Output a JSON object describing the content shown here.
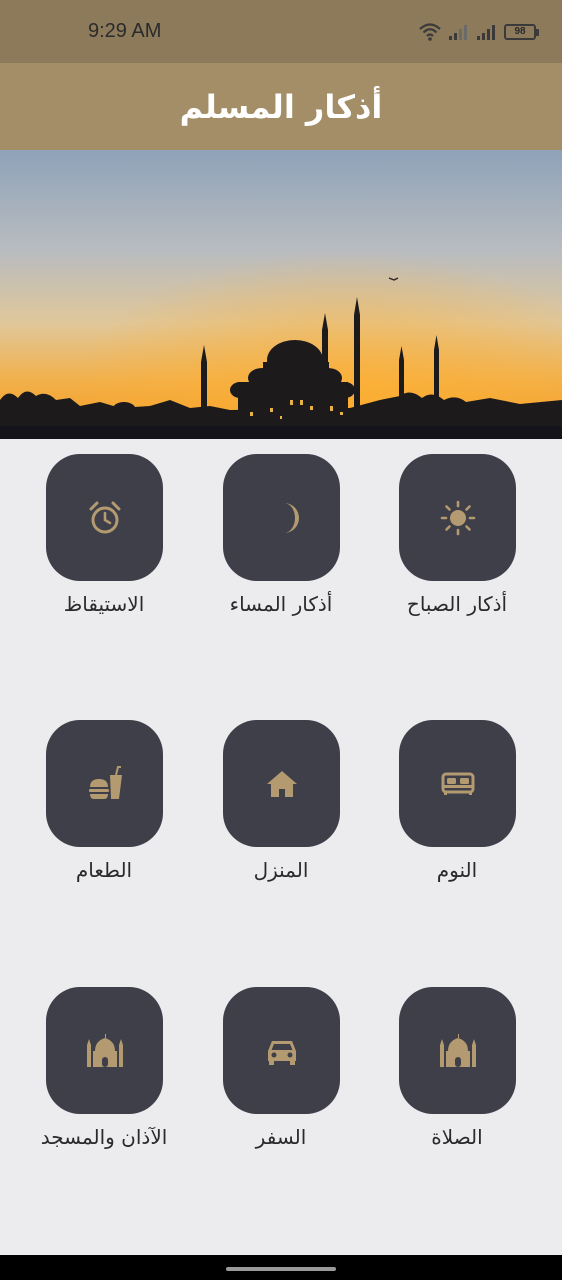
{
  "status_bar": {
    "time": "9:29 AM",
    "battery": "98",
    "icons": [
      "wifi-icon",
      "signal-icon",
      "signal-icon",
      "battery-icon"
    ]
  },
  "app_bar": {
    "title": "أذكار المسلم"
  },
  "hero": {
    "image": "mosque-sunset-silhouette"
  },
  "colors": {
    "status_bar": "#8c7a5b",
    "app_bar": "#a48e68",
    "tile": "#3e3f48",
    "icon": "#b39a70",
    "background": "#ececef"
  },
  "tiles": [
    {
      "label": "أذكار الصباح",
      "icon": "sun-icon"
    },
    {
      "label": "أذكار المساء",
      "icon": "moon-icon"
    },
    {
      "label": "الاستيقاظ",
      "icon": "alarm-clock-icon"
    },
    {
      "label": "النوم",
      "icon": "bed-icon"
    },
    {
      "label": "المنزل",
      "icon": "home-icon"
    },
    {
      "label": "الطعام",
      "icon": "food-icon"
    },
    {
      "label": "الصلاة",
      "icon": "mosque-icon"
    },
    {
      "label": "السفر",
      "icon": "car-icon"
    },
    {
      "label": "الآذان والمسجد",
      "icon": "mosque-icon"
    }
  ]
}
